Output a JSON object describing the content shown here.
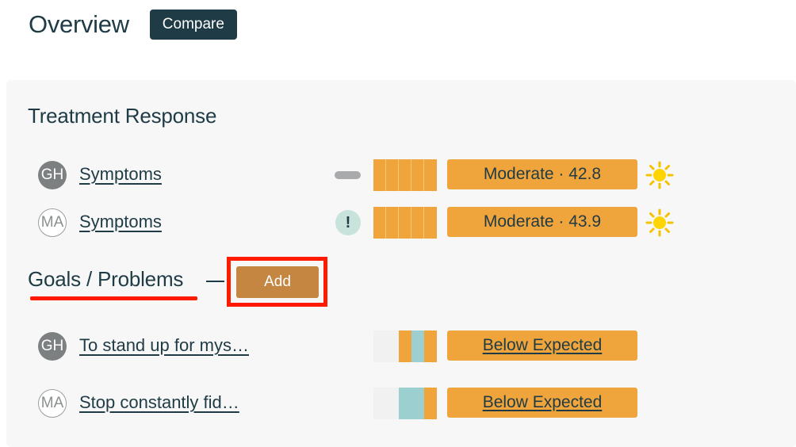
{
  "header": {
    "title": "Overview",
    "compare_label": "Compare"
  },
  "treatment_response": {
    "title": "Treatment Response",
    "rows": [
      {
        "avatar": "GH",
        "label": "Symptoms",
        "status_icon": "dash-icon",
        "badge": "Moderate · 42.8",
        "trend_icon": "sun-icon"
      },
      {
        "avatar": "MA",
        "label": "Symptoms",
        "status_icon": "alert-icon",
        "alert_glyph": "!",
        "badge": "Moderate · 43.9",
        "trend_icon": "sun-icon"
      }
    ]
  },
  "goals": {
    "title": "Goals / Problems",
    "add_label": "Add",
    "rows": [
      {
        "avatar": "GH",
        "label": "To stand up for mys…",
        "badge": "Below Expected"
      },
      {
        "avatar": "MA",
        "label": "Stop constantly fid…",
        "badge": "Below Expected"
      }
    ]
  },
  "colors": {
    "primary": "#1f3b45",
    "orange": "#f0a43c",
    "teal": "#9ccfcf",
    "add_button": "#c48640",
    "highlight": "#ff1a00",
    "panel": "#f7f7f7"
  }
}
